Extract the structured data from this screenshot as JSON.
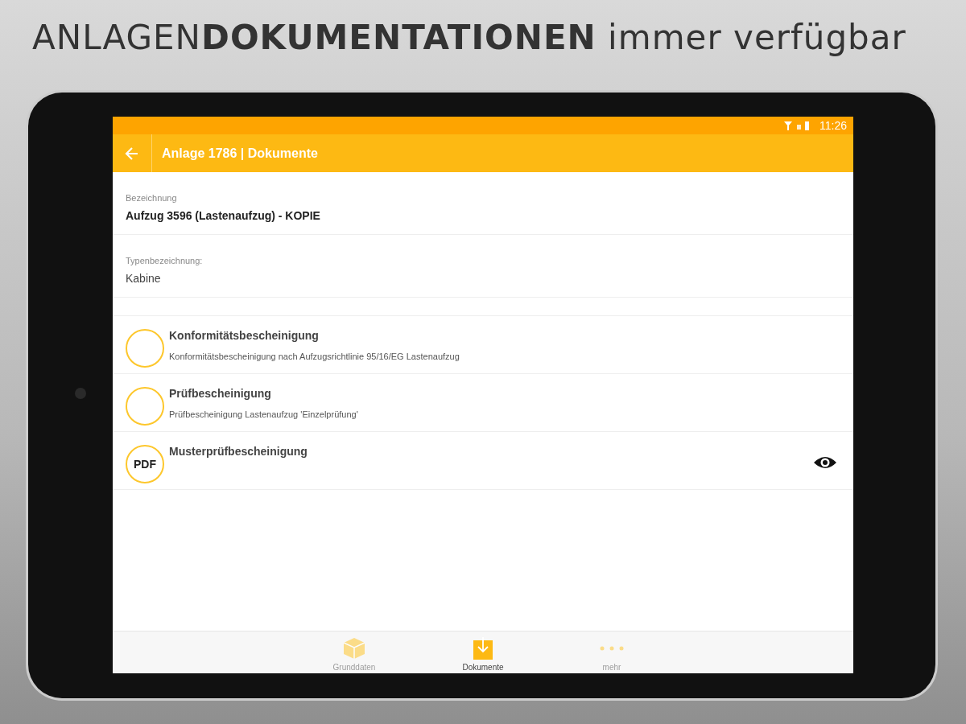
{
  "headline": "ANLAGEN**DOKUMENTATIONEN** immer verfügbar",
  "status_bar": {
    "time": "11:26"
  },
  "toolbar": {
    "title": "Anlage 1786 | Dokumente"
  },
  "fields": [
    {
      "label": "Bezeichnung",
      "value": "Aufzug 3596 (Lastenaufzug) - KOPIE",
      "bold": true
    },
    {
      "label": "Typenbezeichnung:",
      "value": "Kabine",
      "bold": false
    }
  ],
  "documents": [
    {
      "title": "Konformitätsbescheinigung",
      "description": "Konformitätsbescheinigung nach Aufzugsrichtlinie 95/16/EG Lastenaufzug",
      "kind": "empty",
      "viewable": false
    },
    {
      "title": "Prüfbescheinigung",
      "description": "Prüfbescheinigung Lastenaufzug 'Einzelprüfung'",
      "kind": "empty",
      "viewable": false
    },
    {
      "title": "Musterprüfbescheinigung",
      "kind": "pdf",
      "badge": "PDF",
      "viewable": true
    }
  ],
  "bottom_nav": [
    {
      "label": "Grunddaten",
      "kind": "box",
      "selected": false
    },
    {
      "label": "Dokumente",
      "kind": "download",
      "selected": true
    },
    {
      "label": "mehr",
      "kind": "dots",
      "selected": false
    }
  ]
}
